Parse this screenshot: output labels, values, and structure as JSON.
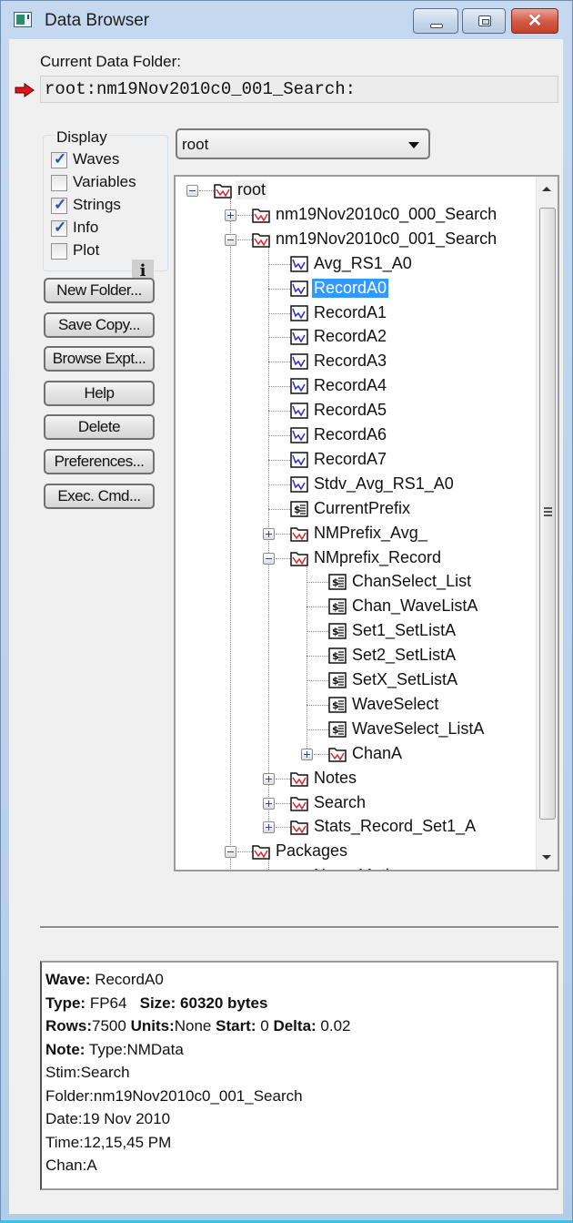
{
  "window": {
    "title": "Data Browser",
    "controls": [
      "minimize",
      "maximize",
      "close"
    ]
  },
  "current_folder": {
    "label": "Current Data Folder:",
    "path": "root:nm19Nov2010c0_001_Search:"
  },
  "display": {
    "title": "Display",
    "options": [
      {
        "label": "Waves",
        "checked": true
      },
      {
        "label": "Variables",
        "checked": false
      },
      {
        "label": "Strings",
        "checked": true
      },
      {
        "label": "Info",
        "checked": true
      },
      {
        "label": "Plot",
        "checked": false
      }
    ],
    "info_button": "i"
  },
  "buttons": [
    {
      "label": "New Folder..."
    },
    {
      "label": "Save Copy..."
    },
    {
      "label": "Browse Expt..."
    },
    {
      "label": "Help"
    },
    {
      "label": "Delete"
    },
    {
      "label": "Preferences..."
    },
    {
      "label": "Exec. Cmd..."
    }
  ],
  "folder_select": {
    "value": "root"
  },
  "tree": [
    {
      "label": "root",
      "type": "folder",
      "depth": 0,
      "expander": "minus",
      "highlight": true
    },
    {
      "label": "nm19Nov2010c0_000_Search",
      "type": "folder",
      "depth": 1,
      "expander": "plus"
    },
    {
      "label": "nm19Nov2010c0_001_Search",
      "type": "folder",
      "depth": 1,
      "expander": "minus",
      "current": true
    },
    {
      "label": "Avg_RS1_A0",
      "type": "wave",
      "depth": 2
    },
    {
      "label": "RecordA0",
      "type": "wave",
      "depth": 2,
      "selected": true
    },
    {
      "label": "RecordA1",
      "type": "wave",
      "depth": 2
    },
    {
      "label": "RecordA2",
      "type": "wave",
      "depth": 2
    },
    {
      "label": "RecordA3",
      "type": "wave",
      "depth": 2
    },
    {
      "label": "RecordA4",
      "type": "wave",
      "depth": 2
    },
    {
      "label": "RecordA5",
      "type": "wave",
      "depth": 2
    },
    {
      "label": "RecordA6",
      "type": "wave",
      "depth": 2
    },
    {
      "label": "RecordA7",
      "type": "wave",
      "depth": 2
    },
    {
      "label": "Stdv_Avg_RS1_A0",
      "type": "wave",
      "depth": 2
    },
    {
      "label": "CurrentPrefix",
      "type": "string",
      "depth": 2
    },
    {
      "label": "NMPrefix_Avg_",
      "type": "folder",
      "depth": 2,
      "expander": "plus"
    },
    {
      "label": "NMprefix_Record",
      "type": "folder",
      "depth": 2,
      "expander": "minus"
    },
    {
      "label": "ChanSelect_List",
      "type": "string",
      "depth": 3
    },
    {
      "label": "Chan_WaveListA",
      "type": "string",
      "depth": 3
    },
    {
      "label": "Set1_SetListA",
      "type": "string",
      "depth": 3
    },
    {
      "label": "Set2_SetListA",
      "type": "string",
      "depth": 3
    },
    {
      "label": "SetX_SetListA",
      "type": "string",
      "depth": 3
    },
    {
      "label": "WaveSelect",
      "type": "string",
      "depth": 3
    },
    {
      "label": "WaveSelect_ListA",
      "type": "string",
      "depth": 3
    },
    {
      "label": "ChanA",
      "type": "folder",
      "depth": 3,
      "expander": "plus"
    },
    {
      "label": "Notes",
      "type": "folder",
      "depth": 2,
      "expander": "plus"
    },
    {
      "label": "Search",
      "type": "folder",
      "depth": 2,
      "expander": "plus"
    },
    {
      "label": "Stats_Record_Set1_A",
      "type": "folder",
      "depth": 2,
      "expander": "plus"
    },
    {
      "label": "Packages",
      "type": "folder",
      "depth": 1,
      "expander": "minus"
    },
    {
      "label": "NeuroMatic",
      "type": "folder",
      "depth": 2,
      "expander": "plus"
    }
  ],
  "info": {
    "wave_label": "Wave:",
    "wave_value": "RecordA0",
    "type_label": "Type:",
    "type_value": "FP64",
    "size_label": "Size:",
    "size_value": "60320 bytes",
    "rows_label": "Rows:",
    "rows_value": "7500",
    "units_label": "Units:",
    "units_value": "None",
    "start_label": "Start:",
    "start_value": "0",
    "delta_label": "Delta:",
    "delta_value": "0.02",
    "note_label": "Note:",
    "note_lines": [
      "Type:NMData",
      "Stim:Search",
      "Folder:nm19Nov2010c0_001_Search",
      "Date:19 Nov 2010",
      "Time:12,15,45 PM",
      "Chan:A"
    ]
  },
  "colors": {
    "selection": "#3399ff",
    "current_arrow": "#e0141c",
    "folder_wave_glyph": "#d92a2a",
    "wave_glyph": "#2b2bbf"
  }
}
